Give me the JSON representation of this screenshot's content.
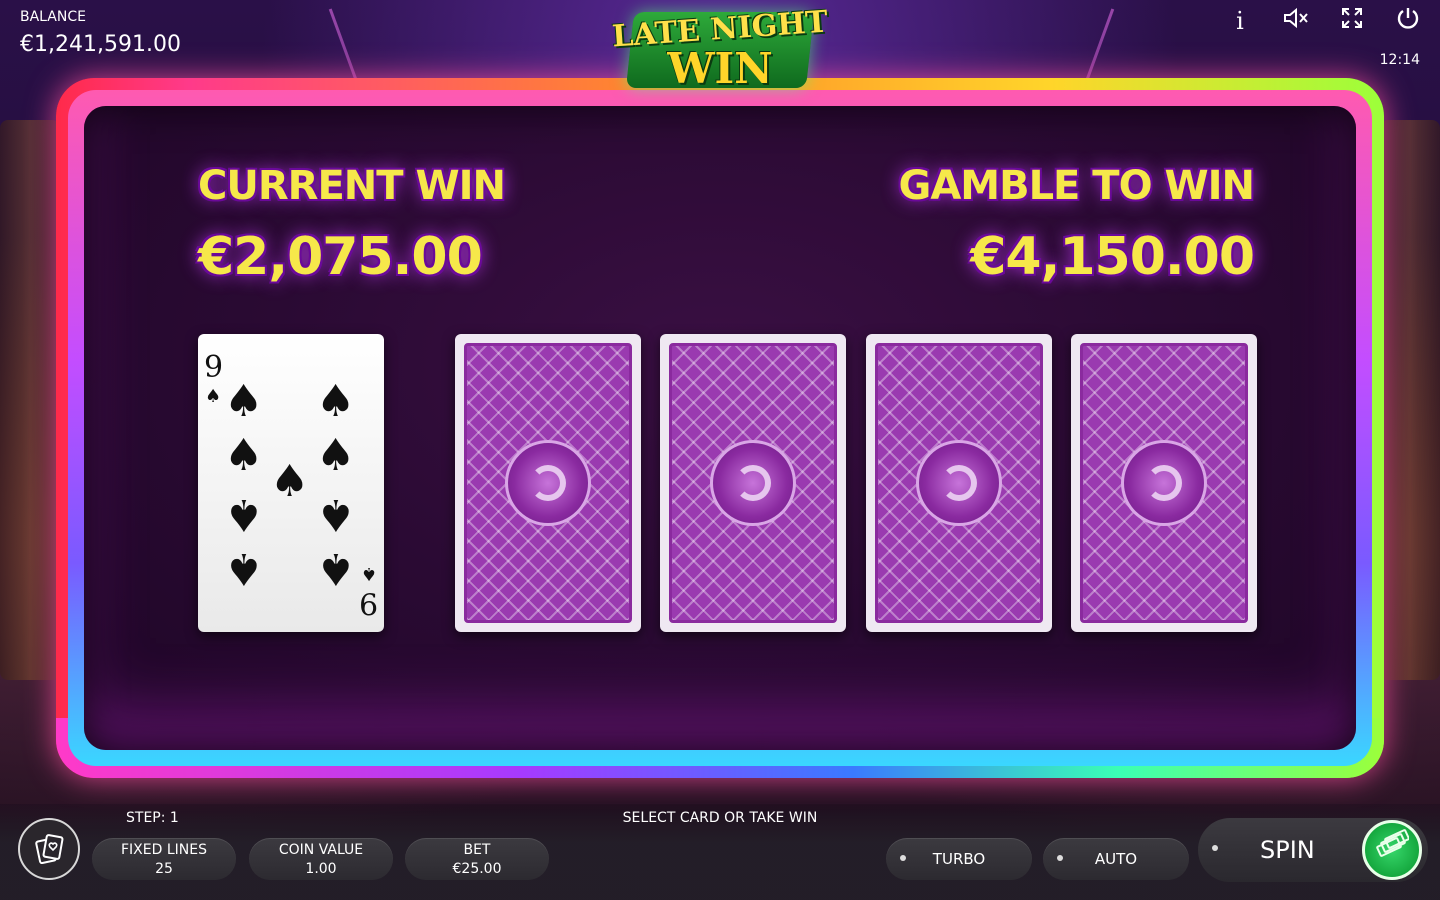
{
  "header": {
    "balance_label": "BALANCE",
    "balance_value": "€1,241,591.00",
    "logo_line1": "LATE NIGHT",
    "logo_line2": "WIN",
    "clock": "12:14",
    "icons": [
      "info-icon",
      "mute-icon",
      "fullscreen-icon",
      "power-icon"
    ]
  },
  "gamble": {
    "current_win_label": "CURRENT WIN",
    "current_win_value": "€2,075.00",
    "gamble_to_win_label": "GAMBLE TO WIN",
    "gamble_to_win_value": "€4,150.00",
    "dealer_card": {
      "rank": "9",
      "suit": "♠",
      "suit_name": "spades"
    },
    "hidden_cards_count": 4
  },
  "footer": {
    "step": "STEP: 1",
    "status": "SELECT CARD OR TAKE WIN",
    "fixed_lines_label": "FIXED LINES",
    "fixed_lines_value": "25",
    "coin_value_label": "COIN VALUE",
    "coin_value_value": "1.00",
    "bet_label": "BET",
    "bet_value": "€25.00",
    "turbo_label": "TURBO",
    "auto_label": "AUTO",
    "spin_label": "SPIN"
  },
  "colors": {
    "win_text": "#f6e84a",
    "win_outline": "#6b0a9a",
    "card_back": "#9a3ab0",
    "spin_green": "#15a83e"
  }
}
